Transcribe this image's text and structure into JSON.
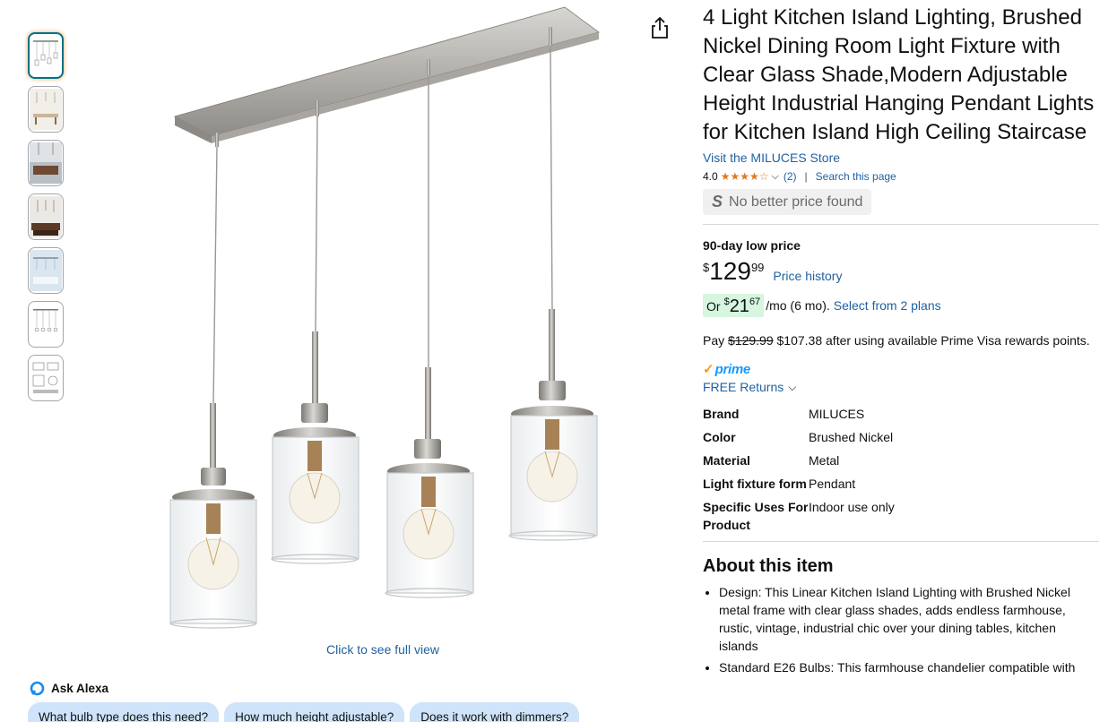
{
  "product": {
    "title": "4 Light Kitchen Island Lighting, Brushed Nickel Dining Room Light Fixture with Clear Glass Shade,Modern Adjustable Height Industrial Hanging Pendant Lights for Kitchen Island High Ceiling Staircase",
    "store_link": "Visit the MILUCES Store",
    "rating": "4.0",
    "rating_stars": 4,
    "review_count": "(2)",
    "rating_separator": "|",
    "search_page": "Search this page",
    "no_better_price": "No better price found",
    "no_better_price_icon": "S"
  },
  "price": {
    "low_label": "90-day low price",
    "symbol": "$",
    "whole": "129",
    "fraction": "99",
    "history_link": "Price history",
    "monthly_or": "Or",
    "monthly_symbol": "$",
    "monthly_whole": "21",
    "monthly_fraction": "67",
    "monthly_rest": "/mo (6 mo).",
    "select_plans": "Select from 2 plans",
    "pay_prefix": "Pay",
    "pay_strike": "$129.99",
    "pay_rest": "$107.38 after using available Prime Visa rewards points."
  },
  "prime": {
    "label": "prime",
    "returns": "FREE Returns"
  },
  "specs": [
    {
      "key": "Brand",
      "value": "MILUCES"
    },
    {
      "key": "Color",
      "value": "Brushed Nickel"
    },
    {
      "key": "Material",
      "value": "Metal"
    },
    {
      "key": "Light fixture form",
      "value": "Pendant"
    },
    {
      "key": "Specific Uses For Product",
      "value": "Indoor use only"
    }
  ],
  "about": {
    "title": "About this item",
    "bullets": [
      "Design: This Linear Kitchen Island Lighting with Brushed Nickel metal frame with clear glass shades, adds endless farmhouse, rustic, vintage, industrial chic over your dining tables, kitchen islands",
      "Standard E26 Bulbs: This farmhouse chandelier compatible with"
    ]
  },
  "gallery": {
    "full_view": "Click to see full view",
    "thumbnail_count": 7
  },
  "alexa": {
    "label": "Ask Alexa",
    "questions": [
      "What bulb type does this need?",
      "How much height adjustable?",
      "Does it work with dimmers?"
    ]
  },
  "colors": {
    "link": "#2162a1",
    "star": "#de7921",
    "prime_blue": "#1399ff",
    "monthly_bg": "#d6f6df",
    "chip_bg": "#cfe4fa"
  }
}
